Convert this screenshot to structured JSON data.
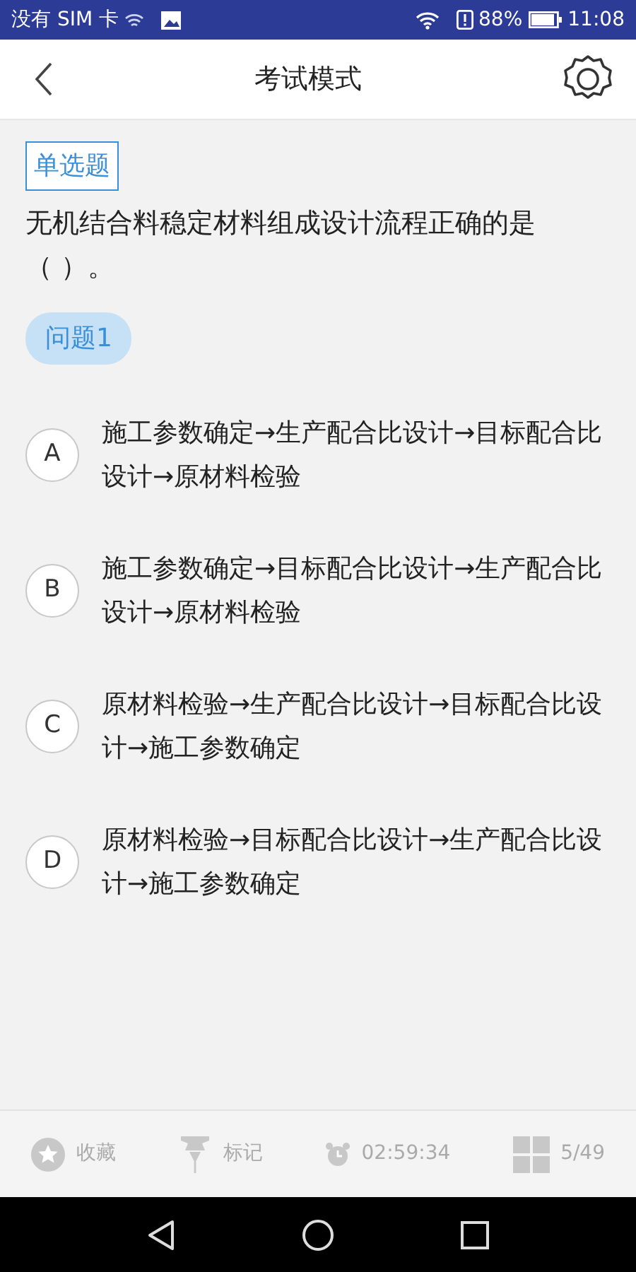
{
  "status_bar": {
    "carrier": "没有 SIM 卡",
    "battery_percent": "88%",
    "time": "11:08"
  },
  "header": {
    "title": "考试模式"
  },
  "question": {
    "type_tag": "单选题",
    "text": "无机结合料稳定材料组成设计流程正确的是（ ）。",
    "number_label": "问题1"
  },
  "options": [
    {
      "letter": "A",
      "text": "施工参数确定→生产配合比设计→目标配合比设计→原材料检验",
      "selected": false
    },
    {
      "letter": "B",
      "text": "施工参数确定→目标配合比设计→生产配合比设计→原材料检验",
      "selected": false
    },
    {
      "letter": "C",
      "text": "原材料检验→生产配合比设计→目标配合比设计→施工参数确定",
      "selected": false
    },
    {
      "letter": "D",
      "text": "原材料检验→目标配合比设计→生产配合比设计→施工参数确定",
      "selected": false
    }
  ],
  "bottom_bar": {
    "favorite": "收藏",
    "mark": "标记",
    "timer": "02:59:34",
    "progress": "5/49"
  }
}
